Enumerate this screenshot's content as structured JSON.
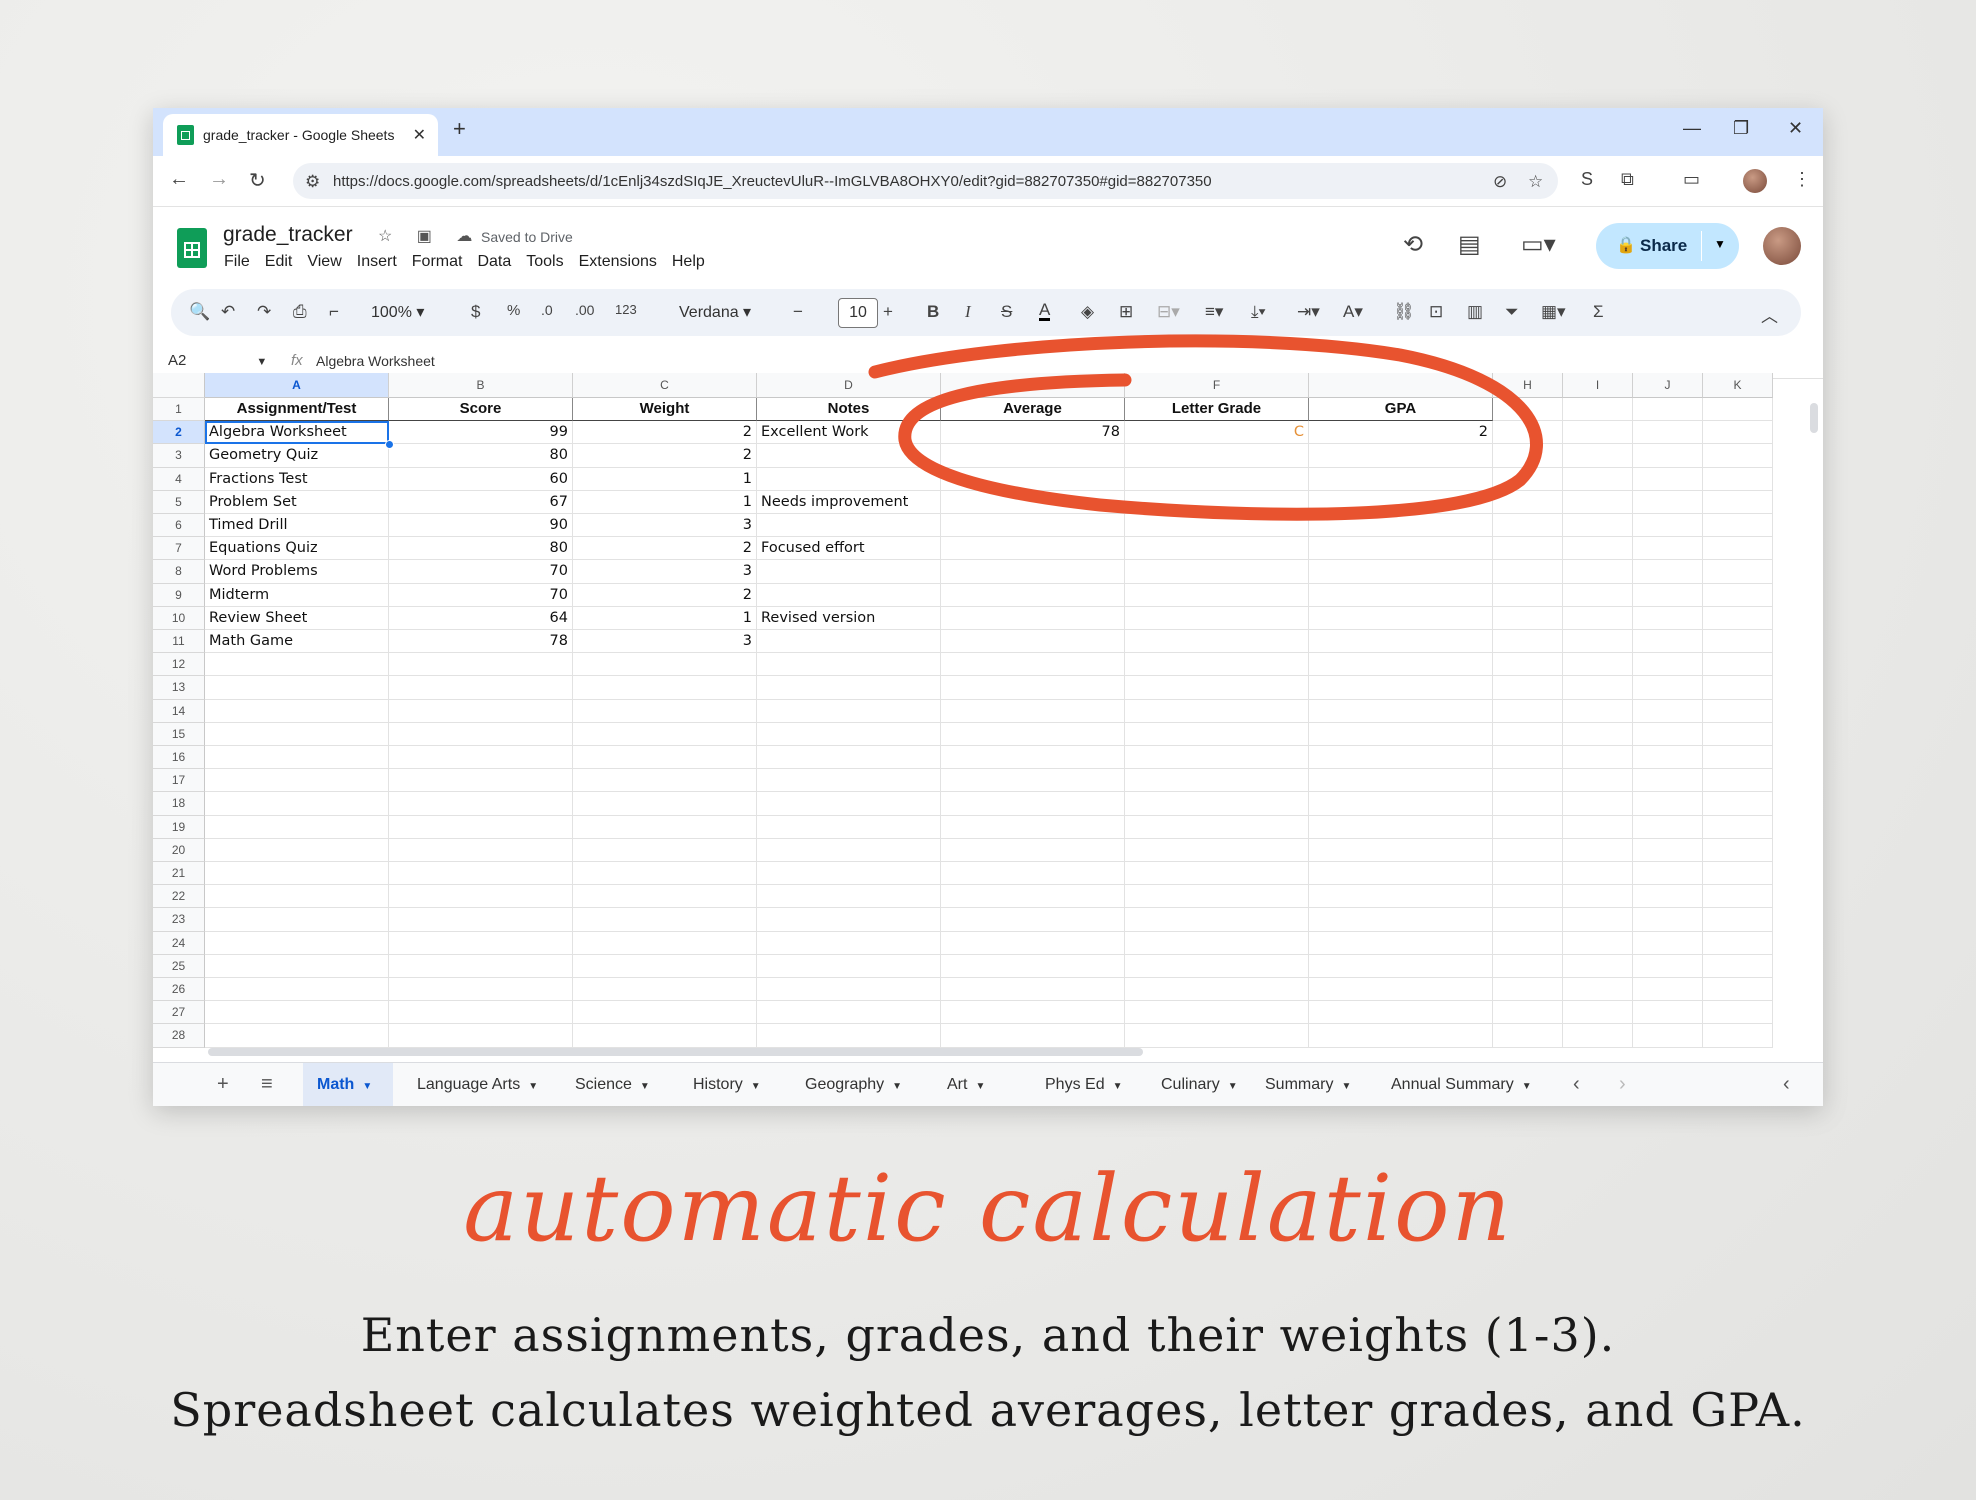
{
  "browser": {
    "tab_title": "grade_tracker - Google Sheets",
    "url": "https://docs.google.com/spreadsheets/d/1cEnlj34szdSIqJE_XreuctevUluR--ImGLVBA8OHXY0/edit?gid=882707350#gid=882707350"
  },
  "sheets": {
    "doc_title": "grade_tracker",
    "saved_status": "Saved to Drive",
    "menu": [
      "File",
      "Edit",
      "View",
      "Insert",
      "Format",
      "Data",
      "Tools",
      "Extensions",
      "Help"
    ],
    "share_label": "Share",
    "zoom": "100%",
    "currency": "$",
    "percent": "%",
    "dec_decrease": ".0",
    "dec_increase": ".00",
    "number_format": "123",
    "font": "Verdana",
    "font_size": "10",
    "bold": "B",
    "italic": "I",
    "strike": "S",
    "text_color": "A",
    "sum": "Σ",
    "name_box": "A2",
    "formula_value": "Algebra Worksheet"
  },
  "grid": {
    "columns": [
      "A",
      "B",
      "C",
      "D",
      "",
      "F",
      "",
      "H",
      "I",
      "J",
      "K"
    ],
    "headers": [
      "Assignment/Test",
      "Score",
      "Weight",
      "Notes",
      "Average",
      "Letter Grade",
      "GPA"
    ],
    "rows": [
      {
        "a": "Algebra Worksheet",
        "b": "99",
        "c": "2",
        "d": "Excellent Work",
        "e": "78",
        "f": "C",
        "g": "2"
      },
      {
        "a": "Geometry Quiz",
        "b": "80",
        "c": "2",
        "d": ""
      },
      {
        "a": "Fractions Test",
        "b": "60",
        "c": "1",
        "d": ""
      },
      {
        "a": "Problem Set",
        "b": "67",
        "c": "1",
        "d": "Needs improvement"
      },
      {
        "a": "Timed Drill",
        "b": "90",
        "c": "3",
        "d": ""
      },
      {
        "a": "Equations Quiz",
        "b": "80",
        "c": "2",
        "d": "Focused effort"
      },
      {
        "a": "Word Problems",
        "b": "70",
        "c": "3",
        "d": ""
      },
      {
        "a": "Midterm",
        "b": "70",
        "c": "2",
        "d": ""
      },
      {
        "a": "Review Sheet",
        "b": "64",
        "c": "1",
        "d": "Revised version"
      },
      {
        "a": "Math Game",
        "b": "78",
        "c": "3",
        "d": ""
      }
    ],
    "row_numbers": [
      "1",
      "2",
      "3",
      "4",
      "5",
      "6",
      "7",
      "8",
      "9",
      "10",
      "11",
      "12",
      "13",
      "14",
      "15",
      "16",
      "17",
      "18",
      "19",
      "20",
      "21",
      "22",
      "23",
      "24",
      "25",
      "26",
      "27",
      "28"
    ]
  },
  "sheet_tabs": [
    "Math",
    "Language Arts",
    "Science",
    "History",
    "Geography",
    "Art",
    "Phys Ed",
    "Culinary",
    "Summary",
    "Annual Summary"
  ],
  "promo": {
    "script_title": "automatic calculation",
    "line1": "Enter assignments, grades, and their weights (1-3).",
    "line2": "Spreadsheet calculates weighted averages, letter grades, and GPA."
  },
  "colors": {
    "accent": "#e8532f",
    "letter_grade": "#e69138",
    "selection": "#1a73e8",
    "share_bg": "#c2e7ff"
  }
}
